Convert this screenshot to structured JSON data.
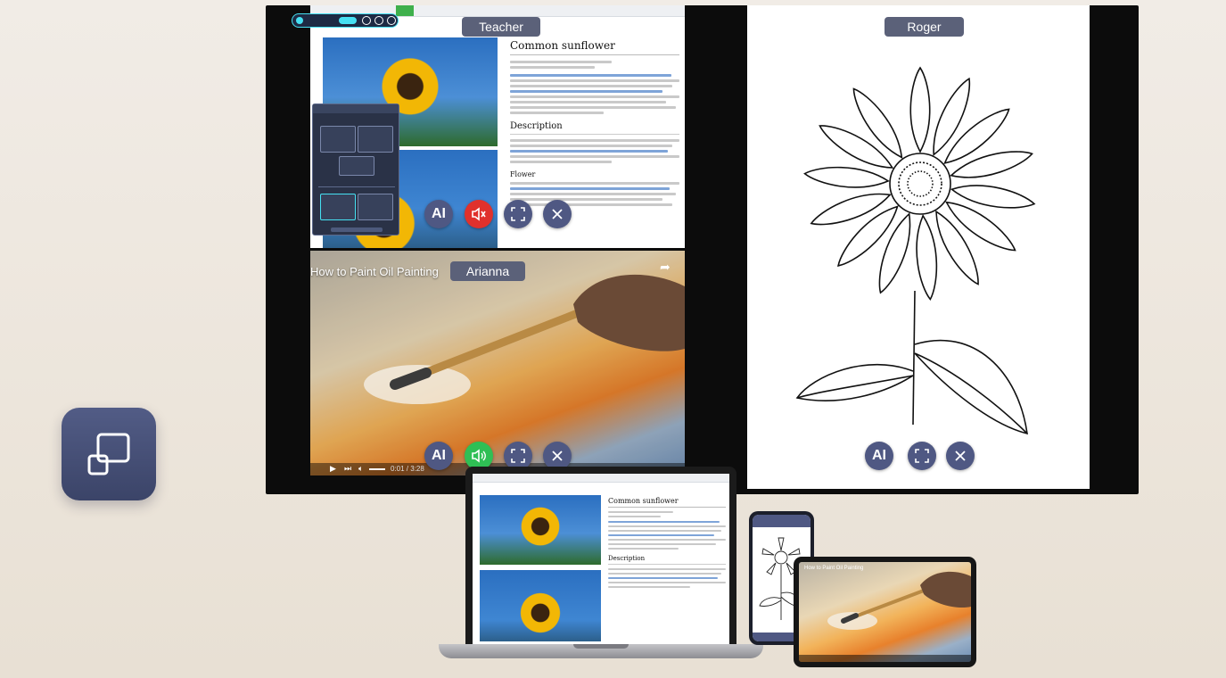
{
  "cast_app": {
    "icon": "cast-screen-icon"
  },
  "tv": {
    "teacher": {
      "name": "Teacher",
      "article": {
        "title": "Common sunflower",
        "section_description": "Description",
        "section_flower": "Flower"
      },
      "buttons": {
        "ai": "AI"
      }
    },
    "arianna": {
      "name": "Arianna",
      "video_title": "How to Paint Oil Painting",
      "buttons": {
        "ai": "AI"
      },
      "controls": {
        "time": "0:01 / 3:28"
      }
    },
    "roger": {
      "name": "Roger",
      "buttons": {
        "ai": "AI"
      }
    }
  },
  "laptop": {
    "article_title": "Common sunflower",
    "section_description": "Description"
  },
  "tablet": {
    "video_title": "How to Paint Oil Painting"
  },
  "colors": {
    "tag_bg": "#5b6179",
    "button_bg": "#4f5883",
    "mute_red": "#e0312c",
    "sound_green": "#2fbf55"
  }
}
